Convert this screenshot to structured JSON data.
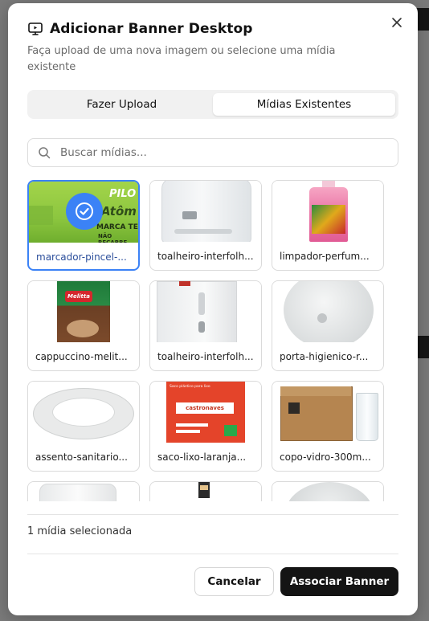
{
  "dialog": {
    "title": "Adicionar Banner Desktop",
    "subtitle": "Faça upload de uma nova imagem ou selecione uma mídia existente",
    "close_label": "×"
  },
  "tabs": [
    {
      "label": "Fazer Upload",
      "active": false
    },
    {
      "label": "Mídias Existentes",
      "active": true
    }
  ],
  "search": {
    "placeholder": "Buscar mídias..."
  },
  "media": [
    {
      "label": "marcador-pincel-...",
      "selected": true,
      "thumb": "marker"
    },
    {
      "label": "toalheiro-interfolh...",
      "selected": false,
      "thumb": "towel-dispenser"
    },
    {
      "label": "limpador-perfum...",
      "selected": false,
      "thumb": "cleaner-bottle"
    },
    {
      "label": "cappuccino-melit...",
      "selected": false,
      "thumb": "coffee-pack"
    },
    {
      "label": "toalheiro-interfolh...",
      "selected": false,
      "thumb": "towel-dispenser-2"
    },
    {
      "label": "porta-higienico-r...",
      "selected": false,
      "thumb": "tp-holder"
    },
    {
      "label": "assento-sanitario...",
      "selected": false,
      "thumb": "toilet-seat"
    },
    {
      "label": "saco-lixo-laranja...",
      "selected": false,
      "thumb": "trash-bag"
    },
    {
      "label": "copo-vidro-300m...",
      "selected": false,
      "thumb": "glass-box"
    },
    {
      "label": "",
      "selected": false,
      "thumb": "mug"
    },
    {
      "label": "",
      "selected": false,
      "thumb": "figure"
    },
    {
      "label": "",
      "selected": false,
      "thumb": "round"
    }
  ],
  "footer": {
    "selected_count": "1 mídia selecionada",
    "cancel_label": "Cancelar",
    "confirm_label": "Associar Banner"
  },
  "marker_text": {
    "brand": "PILO",
    "line1": "Atôm",
    "line2": "MARCA TE",
    "line3": "NÃO RECARRE"
  },
  "coffee_text": {
    "brand": "Melitta"
  },
  "bag_text": {
    "brand": "castronaves",
    "line": "Saco plástico para lixo"
  },
  "colors": {
    "accent": "#3b82f6",
    "primary_btn": "#141414",
    "selected_label": "#2b4e9b"
  },
  "icons": {
    "title": "monitor-play-icon",
    "close": "close-icon",
    "search": "search-icon",
    "check": "check-circle-icon"
  }
}
